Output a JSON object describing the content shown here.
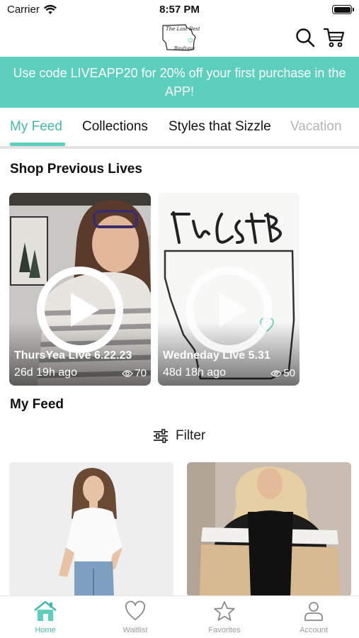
{
  "status_bar": {
    "carrier": "Carrier",
    "time": "8:57 PM",
    "icons": [
      "wifi-icon",
      "battery-icon"
    ]
  },
  "header": {
    "logo_text_line1": "The Last Best",
    "logo_text_line2": "Boutique",
    "icons": [
      "search-icon",
      "cart-icon"
    ]
  },
  "promo": {
    "text": "Use code LIVEAPP20 for 20% off your first purchase in the APP!",
    "background": "#5ccfbd"
  },
  "tabs": [
    {
      "label": "My Feed",
      "active": true
    },
    {
      "label": "Collections",
      "active": false
    },
    {
      "label": "Styles that Sizzle",
      "active": false
    },
    {
      "label": "Vacation",
      "active": false
    }
  ],
  "accent_color": "#45b9a8",
  "previous_lives": {
    "title": "Shop Previous Lives",
    "items": [
      {
        "title": "ThursYea Live 6.22.23",
        "age": "26d 19h ago",
        "views": "70"
      },
      {
        "title": "Wedneday Live 5.31",
        "age": "48d 18h ago",
        "views": "50"
      }
    ]
  },
  "feed": {
    "title": "My Feed",
    "filter_label": "Filter"
  },
  "bottom_nav": [
    {
      "label": "Home",
      "icon": "home-icon",
      "active": true
    },
    {
      "label": "Waitlist",
      "icon": "heart-icon",
      "active": false
    },
    {
      "label": "Favorites",
      "icon": "star-icon",
      "active": false
    },
    {
      "label": "Account",
      "icon": "person-icon",
      "active": false
    }
  ]
}
